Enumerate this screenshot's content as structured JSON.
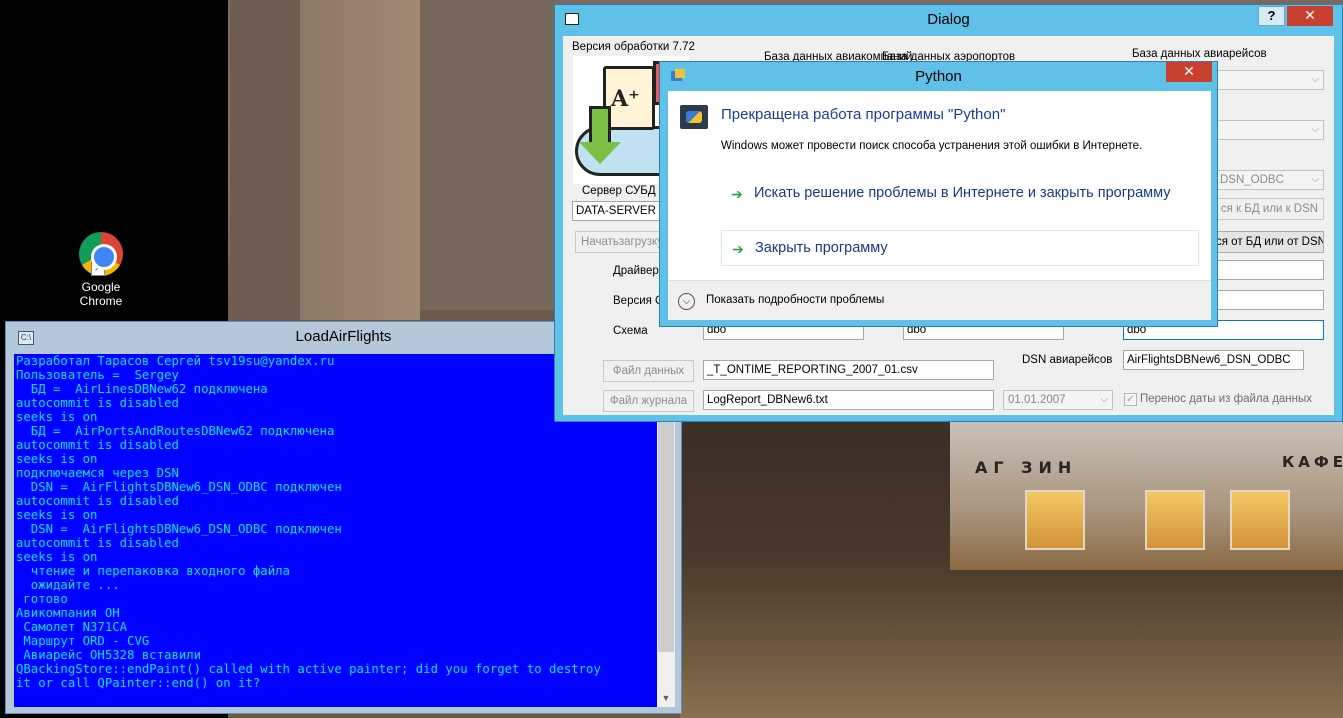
{
  "desktop": {
    "icons": [
      {
        "label_line1": "Google",
        "label_line2": "Chrome"
      }
    ],
    "shop_sign_left": "АГ ЗИН",
    "shop_sign_right": "КАФЕ"
  },
  "console": {
    "title": "LoadAirFlights",
    "lines": [
      "Разработал Тарасов Сергей tsv19su@yandex.ru",
      "Пользователь =  Sergey",
      "  БД =  AirLinesDBNew62 подключена",
      "autocommit is disabled",
      "seeks is on",
      "  БД =  AirPortsAndRoutesDBNew62 подключена",
      "autocommit is disabled",
      "seeks is on",
      "подключаемся через DSN",
      "  DSN =  AirFlightsDBNew6_DSN_ODBC подключен",
      "autocommit is disabled",
      "seeks is on",
      "  DSN =  AirFlightsDBNew6_DSN_ODBC подключен",
      "autocommit is disabled",
      "seeks is on",
      "  чтение и перепаковка входного файла",
      "  ожидайте ...",
      " готово",
      "Авикомпания OH",
      " Самолет N371CA",
      " Маршрут ORD - CVG",
      " Авиарейс OH5328 вставили",
      "QBackingStore::endPaint() called with active painter; did you forget to destroy",
      "it or call QPainter::end() on it?"
    ]
  },
  "dialog": {
    "title": "Dialog",
    "help": "?",
    "close": "✕",
    "version": "Версия обработки 7.72",
    "labels": {
      "db_airlines": "База данных авиакомпаний",
      "db_airports": "База данных аэропортов",
      "db_flights": "База данных авиарейсов",
      "server": "Сервер СУБД",
      "driver": "Драйвер С",
      "odbc_version": "Версия ОD",
      "schema": "Схема",
      "dsn_flights": "DSN авиарейсов"
    },
    "values": {
      "server": "DATA-SERVER",
      "schema_1": "dbo",
      "schema_2": "dbo",
      "schema_3": "dbo",
      "dsn_combo": "DSN_ODBC",
      "dsn_flights": "AirFlightsDBNew6_DSN_ODBC",
      "data_file": "_T_ONTIME_REPORTING_2007_01.csv",
      "log_file": "LogReport_DBNew6.txt",
      "date": "01.01.2007"
    },
    "buttons": {
      "start_load": "Начатьзагрузку",
      "connect": "ся к БД или к DSN",
      "disconnect": "ся от БД или от DSN",
      "data_file": "Файл данных",
      "log_file": "Файл журнала"
    },
    "checkbox_label": "Перенос даты из файла данных"
  },
  "python_error": {
    "title": "Python",
    "close": "✕",
    "heading": "Прекращена работа программы \"Python\"",
    "description": "Windows может провести поиск способа устранения этой ошибки в Интернете.",
    "options": [
      "Искать решение проблемы в Интернете и закрыть программу",
      "Закрыть программу"
    ],
    "details": "Показать подробности проблемы"
  },
  "colors": {
    "console_bg": "#0000ff",
    "console_text": "#00e5ff",
    "window_frame": "#5fc1e8",
    "close_button": "#c74030",
    "link_text": "#163a8a",
    "arrow_green": "#2aa53a"
  }
}
